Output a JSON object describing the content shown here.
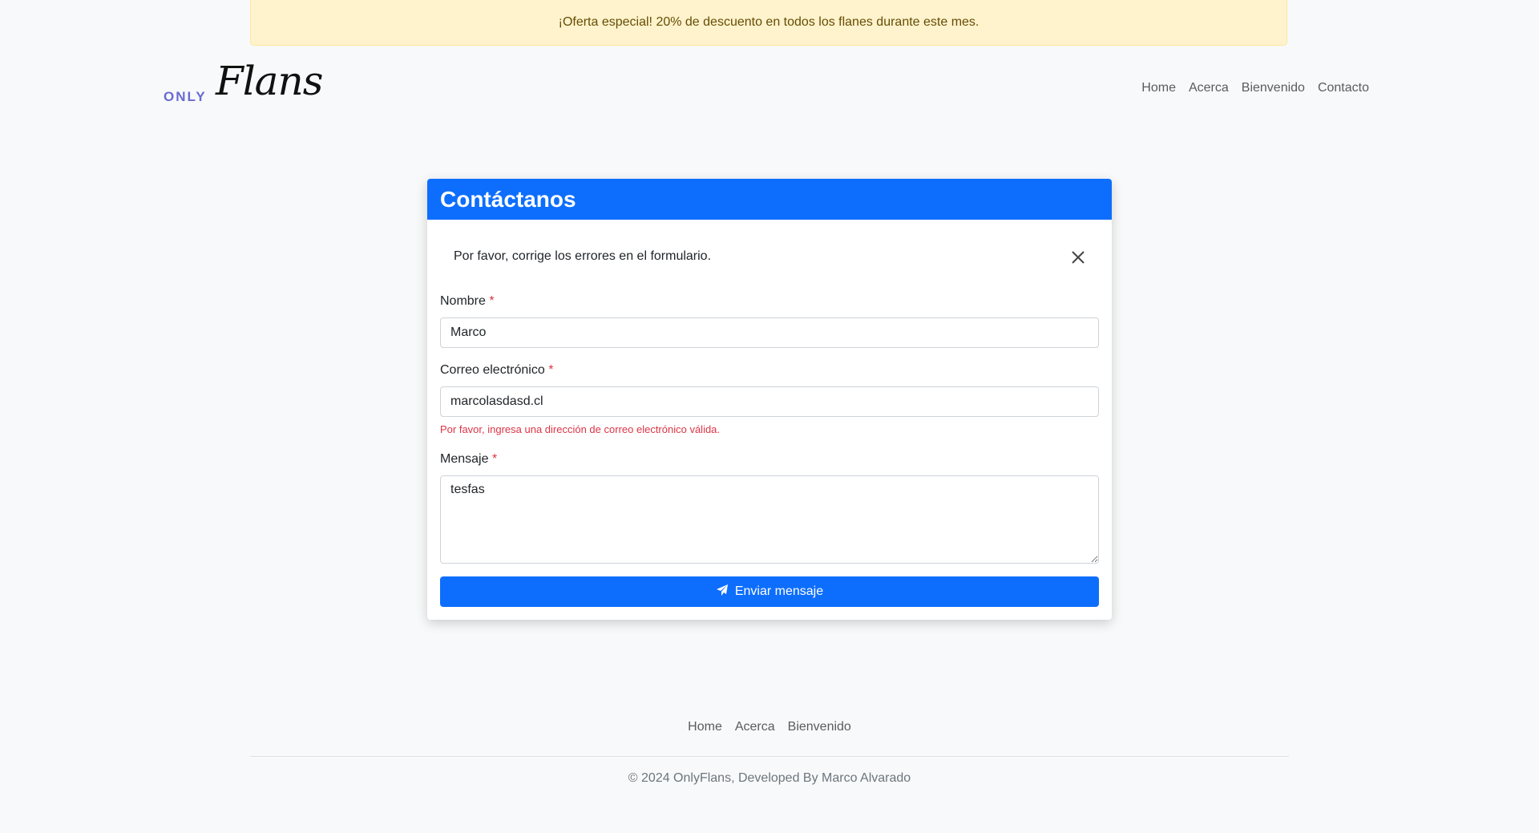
{
  "promo": {
    "text": "¡Oferta especial! 20% de descuento en todos los flanes durante este mes."
  },
  "logo": {
    "only": "ONLY",
    "flans": "Flans"
  },
  "nav": {
    "items": [
      "Home",
      "Acerca",
      "Bienvenido",
      "Contacto"
    ]
  },
  "contact": {
    "title": "Contáctanos",
    "alert": "Por favor, corrige los errores en el formulario.",
    "name_label": "Nombre",
    "name_value": "Marco",
    "email_label": "Correo electrónico",
    "email_value": "marcolasdasd.cl",
    "email_error": "Por favor, ingresa una dirección de correo electrónico válida.",
    "message_label": "Mensaje",
    "message_value": "tesfas",
    "required_mark": "*",
    "submit_label": "Enviar mensaje",
    "submit_icon": "paper-plane-icon"
  },
  "footer": {
    "nav": [
      "Home",
      "Acerca",
      "Bienvenido"
    ],
    "copyright": "© 2024 OnlyFlans, Developed By Marco Alvarado"
  },
  "colors": {
    "primary": "#0d6efd",
    "danger": "#dc3545",
    "promo_bg": "#fff3cd",
    "promo_text": "#664d03",
    "logo_accent": "#6a6ad2"
  }
}
